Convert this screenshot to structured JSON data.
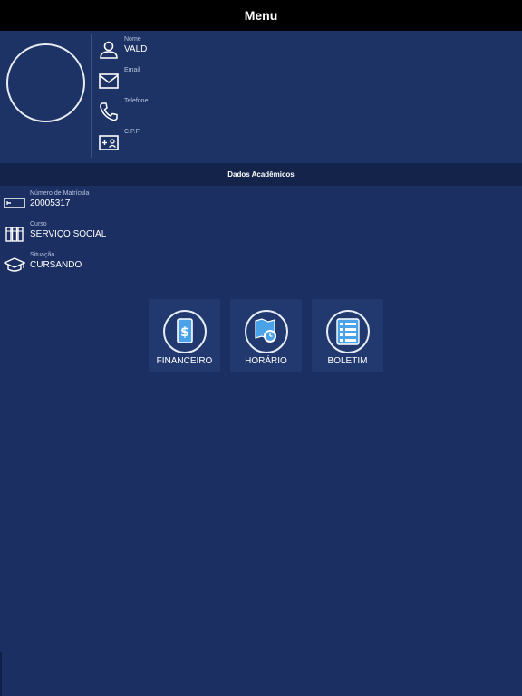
{
  "header": {
    "title": "Menu"
  },
  "profile": {
    "fields": [
      {
        "label": "Nome",
        "value": "VALD",
        "icon": "person-icon"
      },
      {
        "label": "Email",
        "value": "",
        "icon": "envelope-icon"
      },
      {
        "label": "Telefone",
        "value": "",
        "icon": "phone-icon"
      },
      {
        "label": "C.P.F",
        "value": "",
        "icon": "id-card-icon"
      }
    ]
  },
  "academic": {
    "section_title": "Dados Acadêmicos",
    "fields": [
      {
        "label": "Número de Matrícula",
        "value": "20005317",
        "icon": "registration-card-icon"
      },
      {
        "label": "Curso",
        "value": "SERVIÇO SOCIAL",
        "icon": "books-icon"
      },
      {
        "label": "Situação",
        "value": "CURSANDO",
        "icon": "graduation-cap-icon"
      }
    ]
  },
  "menu": {
    "tiles": [
      {
        "label": "FINANCEIRO",
        "icon": "phone-dollar-icon"
      },
      {
        "label": "HORÁRIO",
        "icon": "map-clock-icon"
      },
      {
        "label": "BOLETIM",
        "icon": "report-list-icon"
      }
    ]
  },
  "colors": {
    "background": "#1b2f63",
    "header": "#000000",
    "section_bar": "#13234a",
    "tile": "#22396f",
    "accent_blue": "#4aa3e8"
  }
}
